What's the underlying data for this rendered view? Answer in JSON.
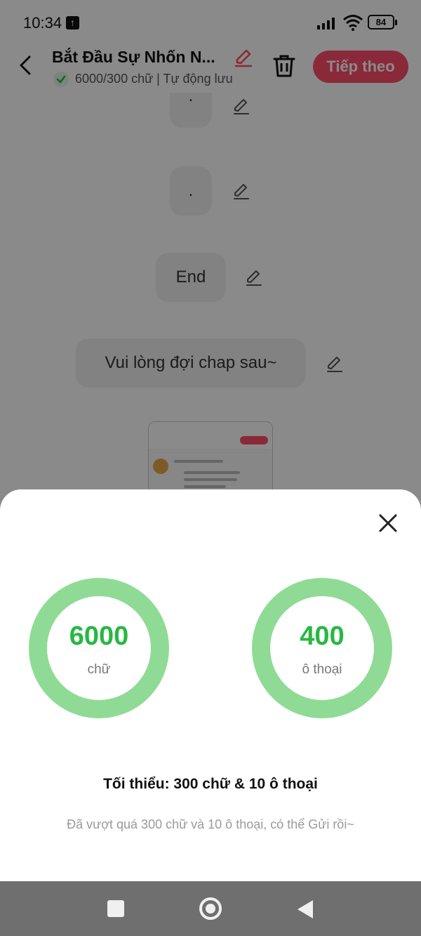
{
  "status_bar": {
    "time": "10:34",
    "battery": "84"
  },
  "header": {
    "title": "Bắt Đầu Sự Nhốn N...",
    "word_status": "6000/300 chữ | Tự động lưu",
    "next_label": "Tiếp theo"
  },
  "chat": {
    "bubbles": [
      ".",
      ".",
      "End",
      "Vui lòng đợi chap sau~"
    ]
  },
  "sheet": {
    "words": {
      "value": "6000",
      "unit": "chữ"
    },
    "dialogs": {
      "value": "400",
      "unit": "ô thoại"
    },
    "minimum": "Tối thiểu: 300 chữ & 10 ô thoại",
    "message": "Đã vượt quá 300 chữ và 10 ô thoại, có thể Gửi rồi~"
  },
  "colors": {
    "accent": "#ff4d6a",
    "ring": "#8fdb95",
    "ring_text": "#27b843"
  }
}
